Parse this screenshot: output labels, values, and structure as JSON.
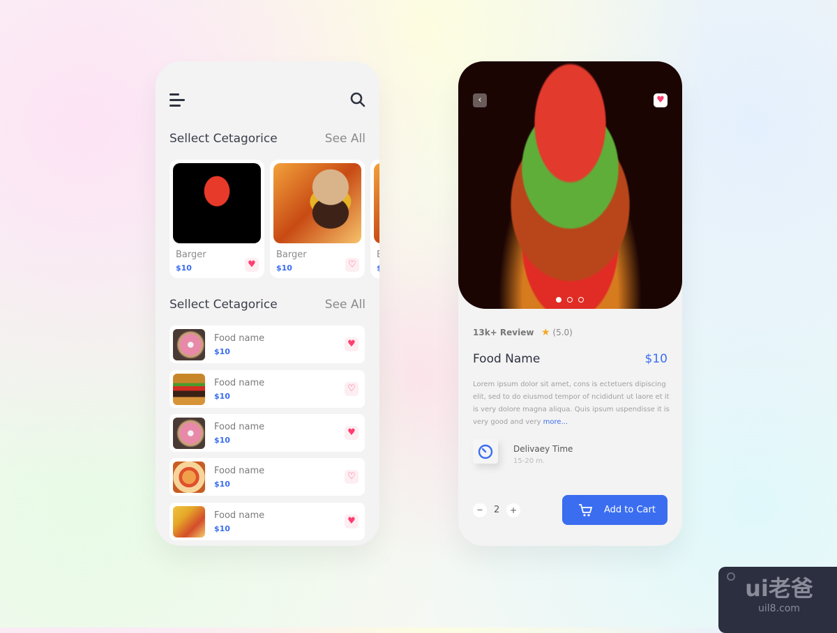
{
  "list_screen": {
    "section1": {
      "title": "Sellect Cetagorice",
      "see_all": "See All"
    },
    "categories": [
      {
        "name": "Barger",
        "price": "$10",
        "favorite": true
      },
      {
        "name": "Barger",
        "price": "$10",
        "favorite": false
      },
      {
        "name": "B",
        "price": "$",
        "favorite": false
      }
    ],
    "section2": {
      "title": "Sellect Cetagorice",
      "see_all": "See All"
    },
    "foods": [
      {
        "name": "Food name",
        "price": "$10",
        "favorite": true,
        "image": "donut"
      },
      {
        "name": "Food name",
        "price": "$10",
        "favorite": false,
        "image": "burger"
      },
      {
        "name": "Food name",
        "price": "$10",
        "favorite": true,
        "image": "donut"
      },
      {
        "name": "Food name",
        "price": "$10",
        "favorite": false,
        "image": "pizza"
      },
      {
        "name": "Food name",
        "price": "$10",
        "favorite": true,
        "image": "pasta"
      }
    ]
  },
  "detail_screen": {
    "review": "13k+ Review",
    "rating": "(5.0)",
    "name": "Food Name",
    "price": "$10",
    "description": "Lorem ipsum dolor sit amet, cons is ectetuers dipiscing elit, sed to do eiusmod tempor of ncididunt ut laore et it is very dolore magna aliqua. Quis ipsum uspendisse it is very good and very ",
    "more": "more...",
    "delivery_label": "Delivaey Time",
    "delivery_time": "15-20 m.",
    "quantity": "2",
    "minus": "−",
    "plus": "+",
    "add_to_cart": "Add to Cart",
    "carousel": {
      "count": 3,
      "active": 1
    }
  },
  "watermark": {
    "logo": "ui老爸",
    "url": "uil8.com"
  },
  "colors": {
    "accent": "#3a6df0",
    "heart": "#ff3d6e",
    "star": "#f5a623"
  }
}
